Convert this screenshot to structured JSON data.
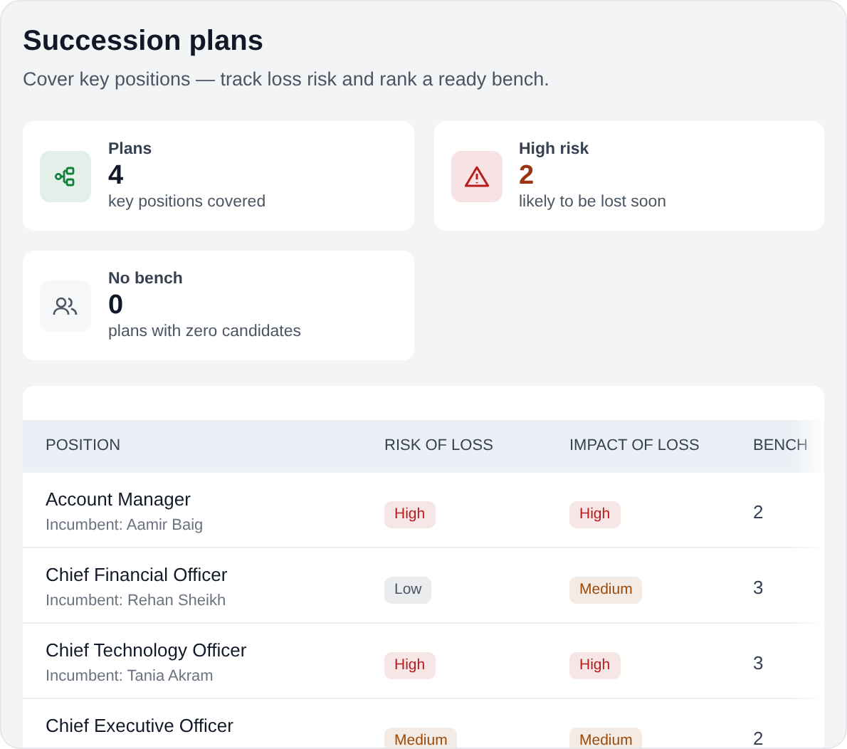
{
  "header": {
    "title": "Succession plans",
    "subtitle": "Cover key positions — track loss risk and rank a ready bench."
  },
  "stats": [
    {
      "kind": "tree",
      "label": "Plans",
      "value": "4",
      "caption": "key positions covered",
      "alert": false
    },
    {
      "kind": "warning",
      "label": "High risk",
      "value": "2",
      "caption": "likely to be lost soon",
      "alert": true
    },
    {
      "kind": "people",
      "label": "No bench",
      "value": "0",
      "caption": "plans with zero candidates",
      "alert": false
    }
  ],
  "table": {
    "columns": [
      "POSITION",
      "RISK OF LOSS",
      "IMPACT OF LOSS",
      "BENCH"
    ],
    "rows": [
      {
        "position": "Account Manager",
        "incumbent": "Incumbent: Aamir Baig",
        "risk": {
          "text": "High",
          "color": "#b91c1c"
        },
        "impact": {
          "text": "High",
          "color": "#b91c1c"
        },
        "bench": "2"
      },
      {
        "position": "Chief Financial Officer",
        "incumbent": "Incumbent: Rehan Sheikh",
        "risk": {
          "text": "Low",
          "color": "#4b5563"
        },
        "impact": {
          "text": "Medium",
          "color": "#9a4a0b"
        },
        "bench": "3"
      },
      {
        "position": "Chief Technology Officer",
        "incumbent": "Incumbent: Tania Akram",
        "risk": {
          "text": "High",
          "color": "#b91c1c"
        },
        "impact": {
          "text": "High",
          "color": "#b91c1c"
        },
        "bench": "3"
      },
      {
        "position": "Chief Executive Officer",
        "risk": {
          "text": "Medium",
          "color": "#9a4a0b"
        },
        "impact": {
          "text": "Medium",
          "color": "#9a4a0b"
        },
        "bench": "2"
      }
    ]
  }
}
